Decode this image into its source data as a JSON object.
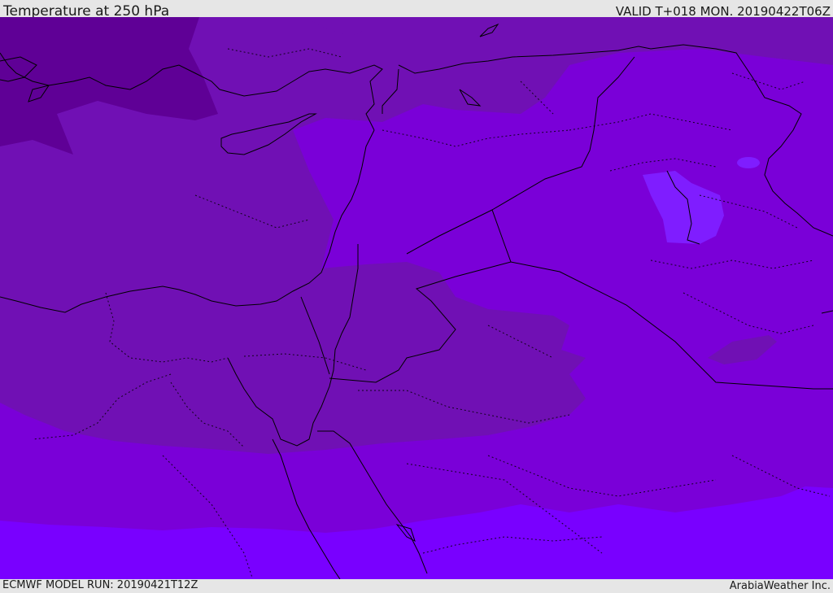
{
  "header": {
    "title": "Temperature at 250 hPa",
    "valid": "VALID T+018 MON. 20190422T06Z"
  },
  "footer": {
    "model_run": "ECMWF MODEL RUN: 20190421T12Z",
    "credit": "ArabiaWeather Inc."
  },
  "colors": {
    "coldest": "#5f0096",
    "cold": "#7010b4",
    "mid": "#7a00d8",
    "warm": "#7900ff",
    "warm_patch": "#7f1dff",
    "land_line": "#000000"
  }
}
